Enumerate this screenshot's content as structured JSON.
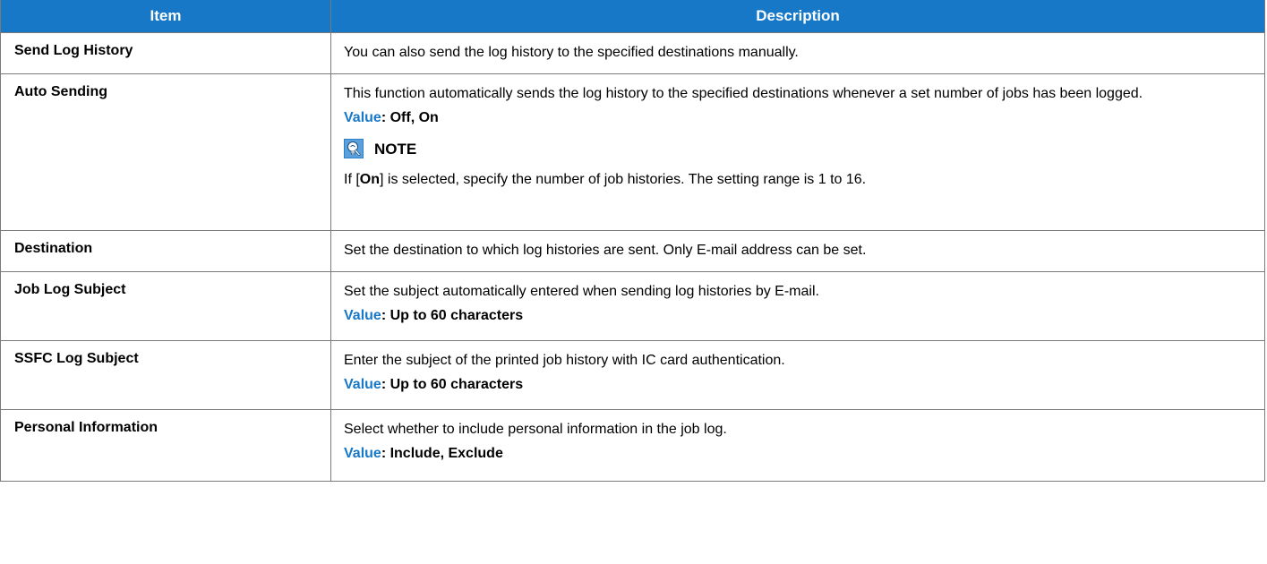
{
  "table": {
    "header": {
      "item": "Item",
      "description": "Description"
    },
    "rows": [
      {
        "item": "Send Log History",
        "description": "You can also send the log history to the specified destinations manually."
      },
      {
        "item": "Auto Sending",
        "description": "This function automatically sends the log history to the specified destinations whenever a set number of jobs has been logged.",
        "value_label": "Value",
        "value_text": ": Off, On",
        "note": {
          "icon": "note-lightbulb-icon",
          "title": "NOTE",
          "text_before": "If [",
          "text_bold": "On",
          "text_after": "] is selected, specify the number of job histories. The setting range is 1 to 16."
        }
      },
      {
        "item": "Destination",
        "description": "Set the destination to which log histories are sent. Only E-mail address can be set."
      },
      {
        "item": "Job Log Subject",
        "description": "Set the subject automatically entered when sending log histories by E-mail.",
        "value_label": "Value",
        "value_text": ": Up to 60 characters"
      },
      {
        "item": "SSFC Log Subject",
        "description": "Enter the subject of the printed job history with IC card authentication.",
        "value_label": "Value",
        "value_text": ": Up to 60 characters"
      },
      {
        "item": "Personal Information",
        "description": "Select whether to include personal information in the job log.",
        "value_label": "Value",
        "value_text": ": Include, Exclude"
      }
    ]
  },
  "colors": {
    "header_bg": "#1778c8",
    "value_label": "#1778c8",
    "border": "#7a7a7a"
  }
}
